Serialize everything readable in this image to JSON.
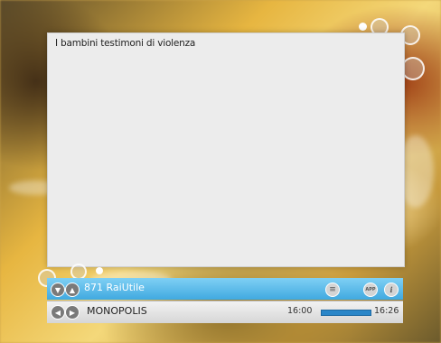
{
  "program": {
    "title": "I bambini testimoni di violenza"
  },
  "channel_bar": {
    "channel": "871 RaiUtile",
    "menu_icon": "menu-lines-icon",
    "app_icon": "app-icon",
    "app_label": "APP",
    "info_icon": "info-icon",
    "info_label": "i"
  },
  "now_bar": {
    "show": "MONOPOLIS",
    "start_time": "16:00",
    "end_time": "16:26",
    "progress": 1.0
  },
  "colors": {
    "accent_blue": "#40a9e0",
    "panel_bg": "#ececec"
  }
}
